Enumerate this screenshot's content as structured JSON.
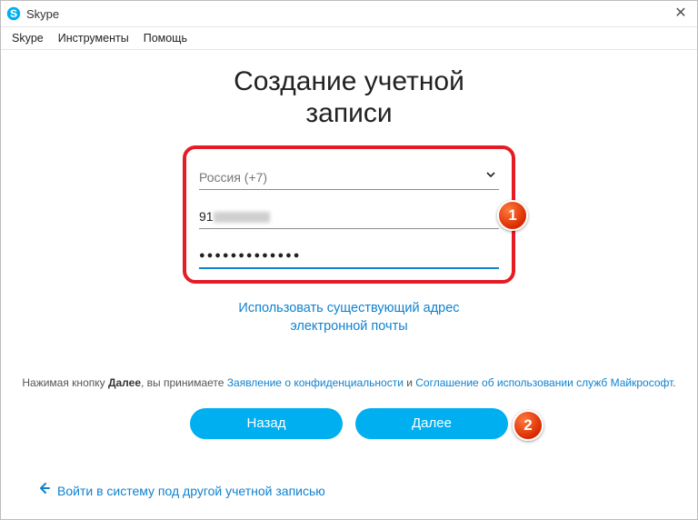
{
  "window": {
    "title": "Skype",
    "close_glyph": "✕"
  },
  "menu": {
    "skype": "Skype",
    "tools": "Инструменты",
    "help": "Помощь"
  },
  "heading_line1": "Создание учетной",
  "heading_line2": "записи",
  "form": {
    "country_label": "Россия (+7)",
    "phone_prefix": "91",
    "password_masked": "●●●●●●●●●●●●●"
  },
  "links": {
    "use_email_line1": "Использовать существующий адрес",
    "use_email_line2": "электронной почты"
  },
  "legal": {
    "prefix": "Нажимая кнопку ",
    "bold_next": "Далее",
    "mid1": ", вы принимаете ",
    "link_privacy": "Заявление о конфиденциальности",
    "mid2": " и ",
    "link_agreement": "Соглашение об использовании служб Майкрософт",
    "suffix": "."
  },
  "buttons": {
    "back": "Назад",
    "next": "Далее"
  },
  "footer": {
    "other_account": "Войти в систему под другой учетной записью"
  },
  "badges": {
    "one": "1",
    "two": "2"
  }
}
